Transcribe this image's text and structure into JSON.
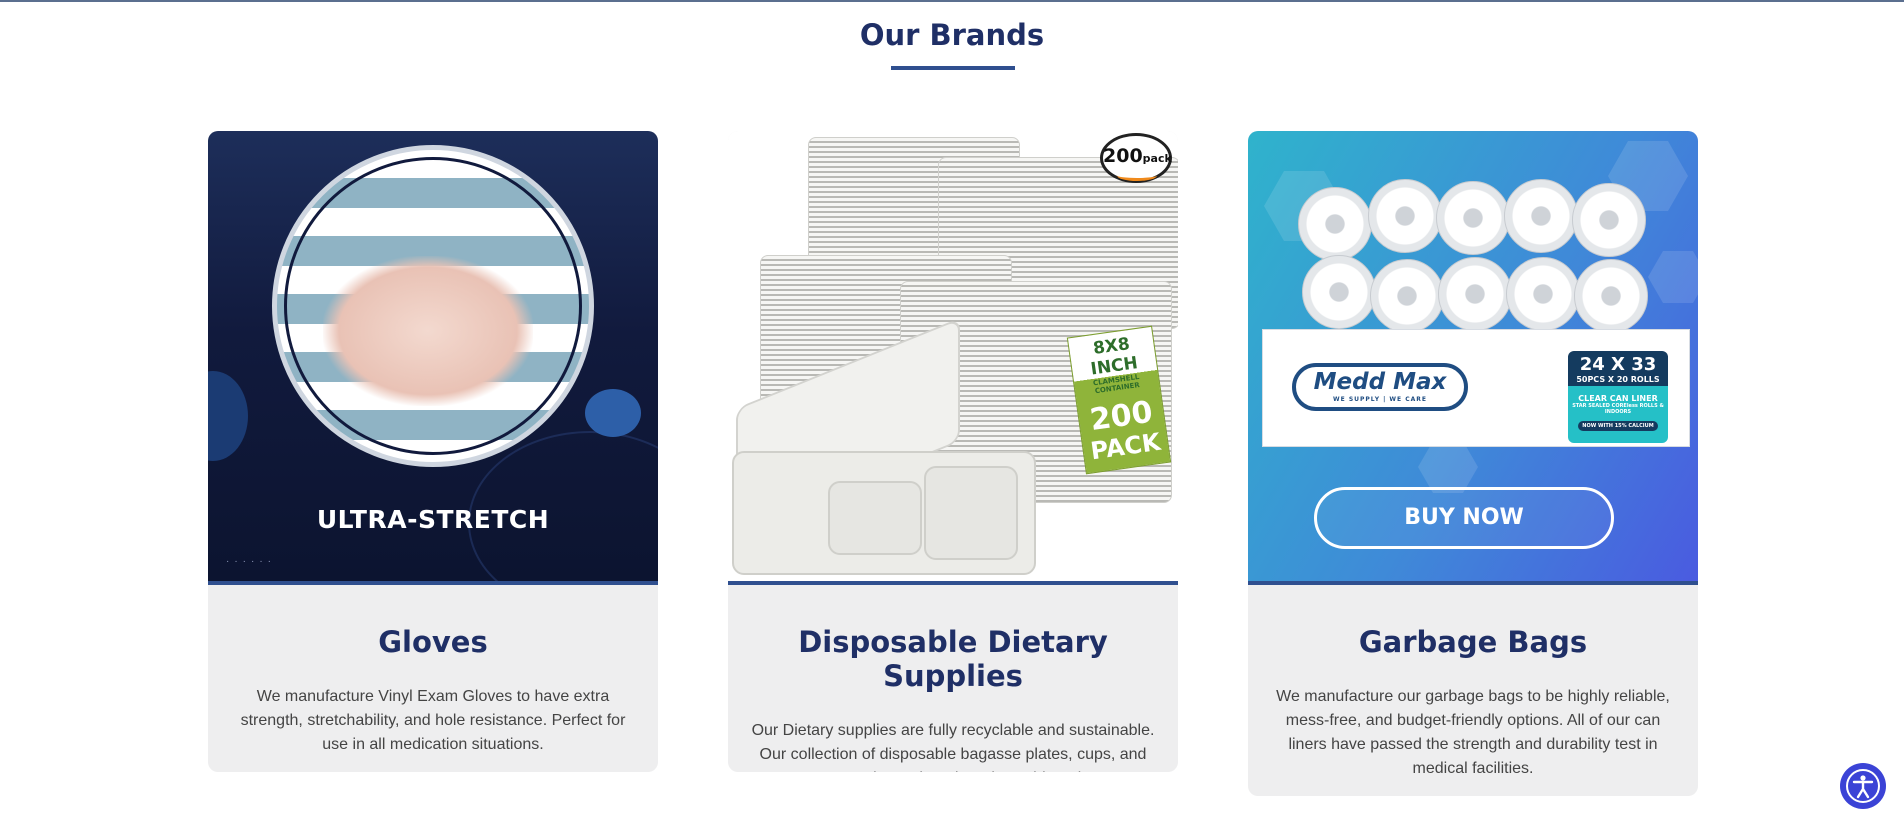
{
  "section": {
    "title": "Our Brands"
  },
  "cards": [
    {
      "image_text": "ULTRA-STRETCH",
      "title": "Gloves",
      "description": "We manufacture Vinyl Exam Gloves to have extra strength, stretchability, and hole resistance. Perfect for use in all medication situations."
    },
    {
      "image_text": {
        "badge_number": "200",
        "badge_unit": "pack",
        "label_size": "8X8 INCH",
        "label_sub": "CLAMSHELL CONTAINER",
        "label_count": "200",
        "label_pack": "PACK"
      },
      "title": "Disposable Dietary Supplies",
      "description": "Our Dietary supplies are fully recyclable and sustainable. Our collection of disposable bagasse plates, cups, and more are in stock and ready to ship today."
    },
    {
      "image_text": {
        "brand": "Medd Max",
        "brand_tagline": "WE SUPPLY | WE CARE",
        "size": "24 X 33",
        "count": "50PCS X 20 ROLLS",
        "product": "CLEAR CAN LINER",
        "detail": "STAR SEALED COREless ROLLS & INDOORS",
        "feature": "NOW WITH 15% CALCIUM",
        "button": "BUY NOW"
      },
      "title": "Garbage Bags",
      "description": "We manufacture our garbage bags to be highly reliable, mess-free, and budget-friendly options. All of our can liners have passed the strength and durability test in medical facilities."
    }
  ],
  "icons": {
    "accessibility": "accessibility-icon"
  },
  "colors": {
    "heading": "#1f2f66",
    "accent": "#2f4f8f",
    "card_bg": "#eeeeef",
    "accessibility_button": "#3b43d6"
  }
}
